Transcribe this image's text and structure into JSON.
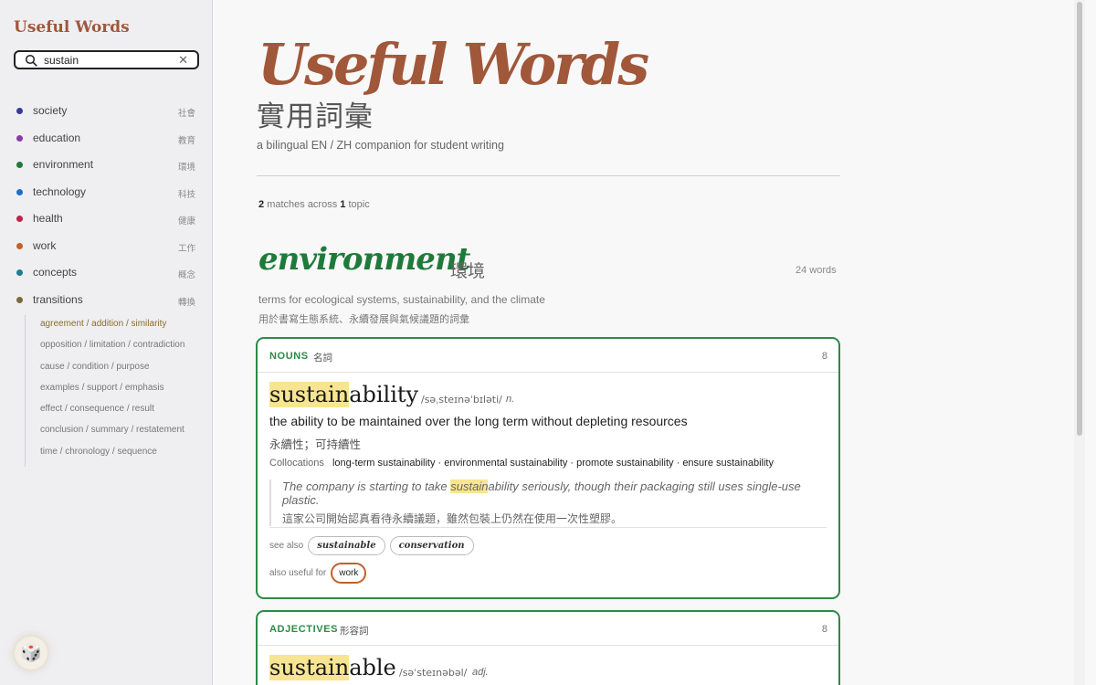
{
  "sidebar": {
    "brand": "Useful Words",
    "search": {
      "value": "sustain",
      "clear_glyph": "✕"
    },
    "topics": [
      {
        "label": "society",
        "zh": "社會",
        "color": "#3a3a9a"
      },
      {
        "label": "education",
        "zh": "教育",
        "color": "#8a3aaa"
      },
      {
        "label": "environment",
        "zh": "環境",
        "color": "#1f7a3a"
      },
      {
        "label": "technology",
        "zh": "科技",
        "color": "#1a6fd0"
      },
      {
        "label": "health",
        "zh": "健康",
        "color": "#c0214a"
      },
      {
        "label": "work",
        "zh": "工作",
        "color": "#c1612a"
      },
      {
        "label": "concepts",
        "zh": "概念",
        "color": "#1b7f8f"
      },
      {
        "label": "transitions",
        "zh": "轉換",
        "color": "#7b6a3e"
      }
    ],
    "subtopics": [
      "agreement / addition / similarity",
      "opposition / limitation / contradiction",
      "cause / condition / purpose",
      "examples / support / emphasis",
      "effect / consequence / result",
      "conclusion / summary / restatement",
      "time / chronology / sequence"
    ],
    "active_subtopic": 0,
    "dice_glyph": "🎲"
  },
  "hero": {
    "title": "Useful Words",
    "title_zh": "實用詞彙",
    "subtitle": "a bilingual EN / ZH companion for student writing"
  },
  "results": {
    "match_count": "2",
    "matches_text": "matches across",
    "topic_count": "1",
    "topic_word": "topic"
  },
  "section": {
    "title": "environment",
    "title_zh": "環境",
    "count": "24 words",
    "desc": "terms for ecological systems, sustainability, and the climate",
    "desc_zh": "用於書寫生態系統、永續發展與氣候議題的詞彙"
  },
  "nouns_card": {
    "pos": "NOUNS",
    "pos_zh": "名詞",
    "count": "8",
    "word_highlight": "sustain",
    "word_rest": "ability",
    "ipa": "/səˌsteɪnəˈbɪləti/",
    "part": "n.",
    "definition": "the ability to be maintained over the long term without depleting resources",
    "definition_zh": "永續性；可持續性",
    "collocations_label": "Collocations",
    "collocations": "long-term sustainability · environmental sustainability · promote sustainability · ensure sustainability",
    "example_before": "The company is starting to take ",
    "example_highlight": "sustain",
    "example_after": "ability seriously, though their packaging still uses single-use plastic.",
    "example_zh": "這家公司開始認真看待永續議題，雖然包裝上仍然在使用一次性塑膠。",
    "see_also_label": "see also",
    "see_also": [
      "sustainable",
      "conservation"
    ],
    "useful_for_label": "also useful for",
    "useful_for": "work"
  },
  "adj_card": {
    "pos": "ADJECTIVES",
    "pos_zh": "形容詞",
    "count": "8",
    "word_highlight": "sustain",
    "word_rest": "able",
    "ipa": "/səˈsteɪnəbəl/",
    "part": "adj."
  },
  "colors": {
    "accent": "#a0573a",
    "green": "#2b8a46",
    "highlight": "#f8e592",
    "work": "#c1612a"
  }
}
